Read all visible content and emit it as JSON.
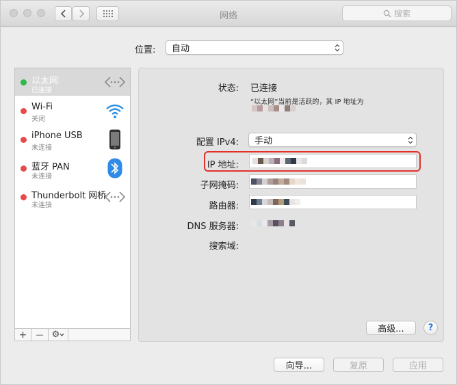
{
  "window": {
    "title": "网络",
    "search_placeholder": "搜索"
  },
  "location": {
    "label": "位置:",
    "value": "自动"
  },
  "services": [
    {
      "name": "以太网",
      "status": "已连接",
      "dot_color": "#2fb84a",
      "icon": "ethernet-arrows-icon",
      "selected": true
    },
    {
      "name": "Wi-Fi",
      "status": "关闭",
      "dot_color": "#e64b4b",
      "icon": "wifi-icon",
      "selected": false
    },
    {
      "name": "iPhone USB",
      "status": "未连接",
      "dot_color": "#e64b4b",
      "icon": "iphone-icon",
      "selected": false
    },
    {
      "name": "蓝牙 PAN",
      "status": "未连接",
      "dot_color": "#e64b4b",
      "icon": "bluetooth-icon",
      "selected": false
    },
    {
      "name": "Thunderbolt 网桥",
      "status": "未连接",
      "dot_color": "#e64b4b",
      "icon": "thunderbolt-arrows-icon",
      "selected": false
    }
  ],
  "sidebar_controls": {
    "add": "+",
    "remove": "—",
    "gear": "⚙"
  },
  "detail": {
    "status_label": "状态:",
    "status_value": "已连接",
    "status_note": "“以太网”当前是活跃的，其 IP 地址为",
    "configure_label": "配置 IPv4:",
    "configure_value": "手动",
    "ip_label": "IP 地址:",
    "subnet_label": "子网掩码:",
    "router_label": "路由器:",
    "dns_label": "DNS 服务器:",
    "search_domain_label": "搜索域:",
    "advanced_button": "高级...",
    "help_button": "?"
  },
  "footer": {
    "assist_button": "向导...",
    "revert_button": "复原",
    "apply_button": "应用"
  },
  "colors": {
    "highlight_border": "#e0322b",
    "connected": "#2fb84a",
    "disconnected": "#e64b4b",
    "selected_row": "#d9d9d9"
  }
}
